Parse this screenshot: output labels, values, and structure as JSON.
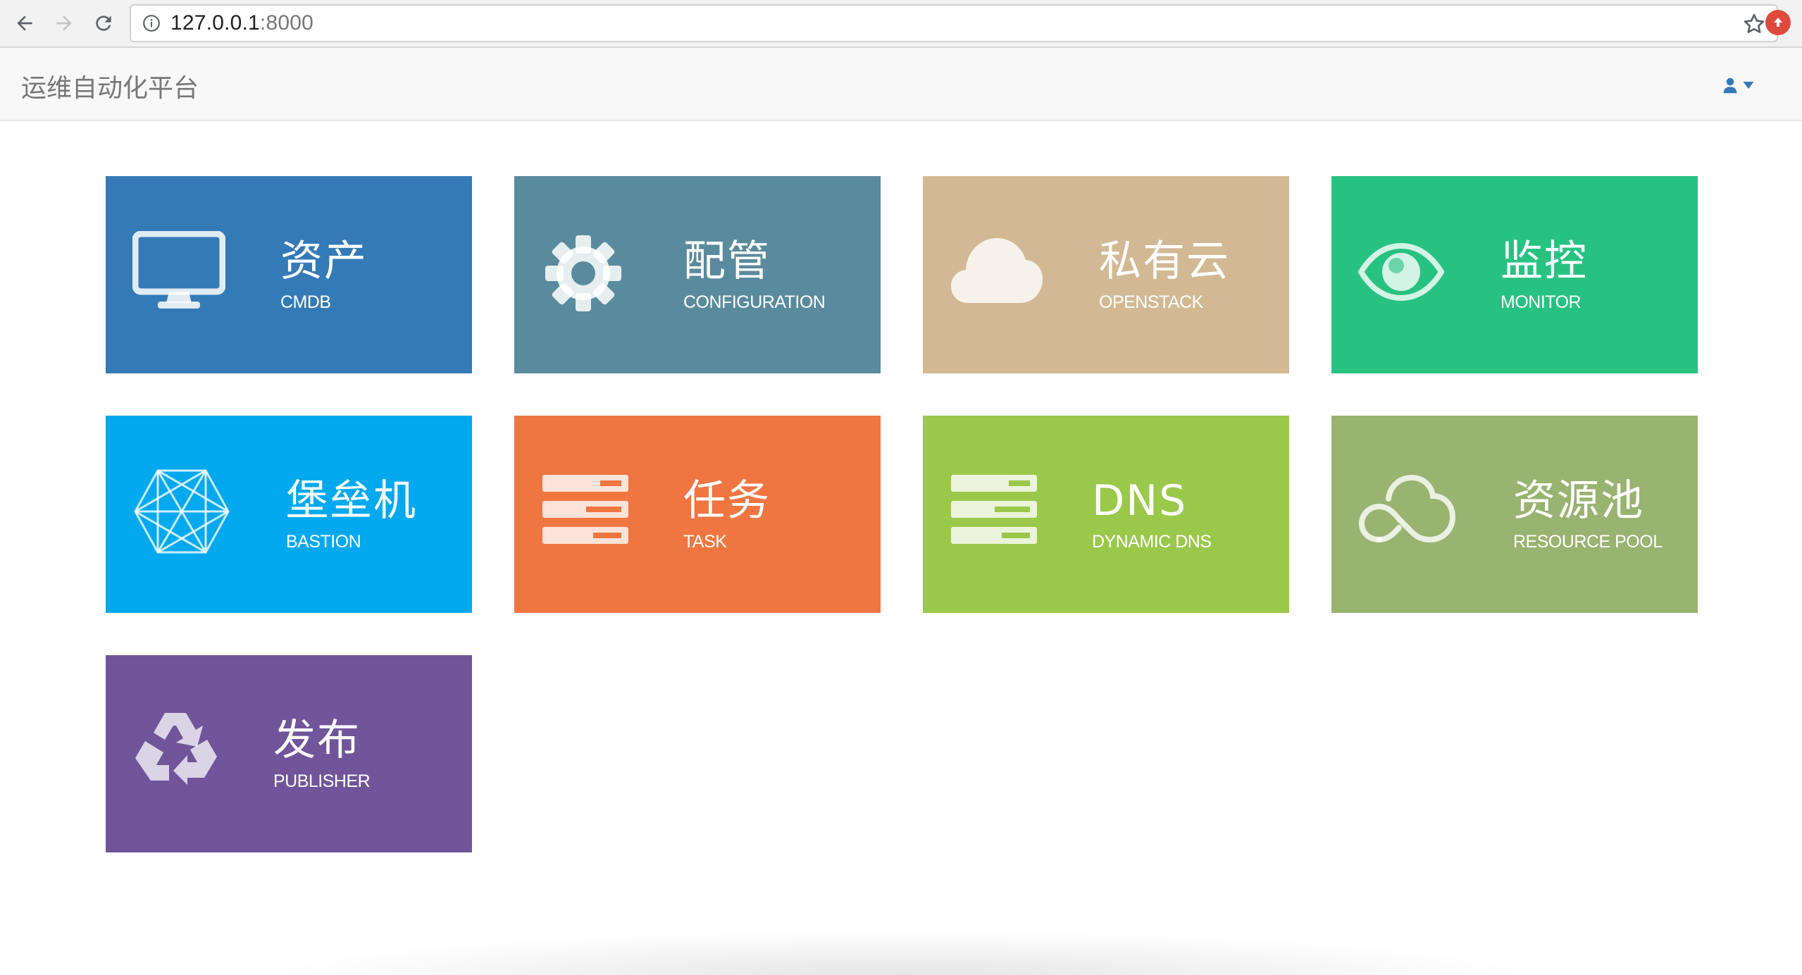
{
  "browser": {
    "url_host": "127.0.0.1",
    "url_port": ":8000"
  },
  "header": {
    "brand": "运维自动化平台"
  },
  "tiles": [
    {
      "title": "资产",
      "subtitle": "CMDB",
      "color": "#337ab7",
      "icon": "desktop-icon"
    },
    {
      "title": "配管",
      "subtitle": "CONFIGURATION",
      "color": "#5a8a9d",
      "icon": "gear-icon"
    },
    {
      "title": "私有云",
      "subtitle": "OPENSTACK",
      "color": "#d2b994",
      "icon": "cloud-icon"
    },
    {
      "title": "监控",
      "subtitle": "MONITOR",
      "color": "#27c281",
      "icon": "eye-icon"
    },
    {
      "title": "堡垒机",
      "subtitle": "BASTION",
      "color": "#03a9ee",
      "icon": "network-polygon-icon"
    },
    {
      "title": "任务",
      "subtitle": "TASK",
      "color": "#f07641",
      "icon": "server-stack-icon"
    },
    {
      "title": "DNS",
      "subtitle": "DYNAMIC DNS",
      "color": "#9ac84a",
      "icon": "server-stack-icon"
    },
    {
      "title": "资源池",
      "subtitle": "RESOURCE POOL",
      "color": "#99b370",
      "icon": "cloud-outline-icon"
    },
    {
      "title": "发布",
      "subtitle": "PUBLISHER",
      "color": "#71559b",
      "icon": "recycle-icon"
    }
  ]
}
